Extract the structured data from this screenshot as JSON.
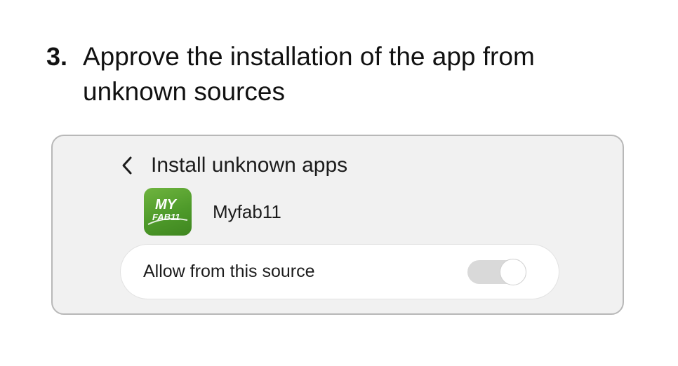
{
  "instruction": {
    "step_number": "3.",
    "text": "Approve the installation of the app from unknown sources"
  },
  "settings_panel": {
    "back_icon": "chevron-left-icon",
    "title": "Install unknown apps",
    "app": {
      "name": "Myfab11",
      "icon": "myfab11-app-icon",
      "icon_text_top": "MY",
      "icon_text_bottom": "FAB11",
      "icon_color": "#4e9a2a"
    },
    "permission": {
      "label": "Allow from this source",
      "enabled": false,
      "track_color": "#d9d9d9",
      "thumb_color": "#ffffff"
    }
  }
}
